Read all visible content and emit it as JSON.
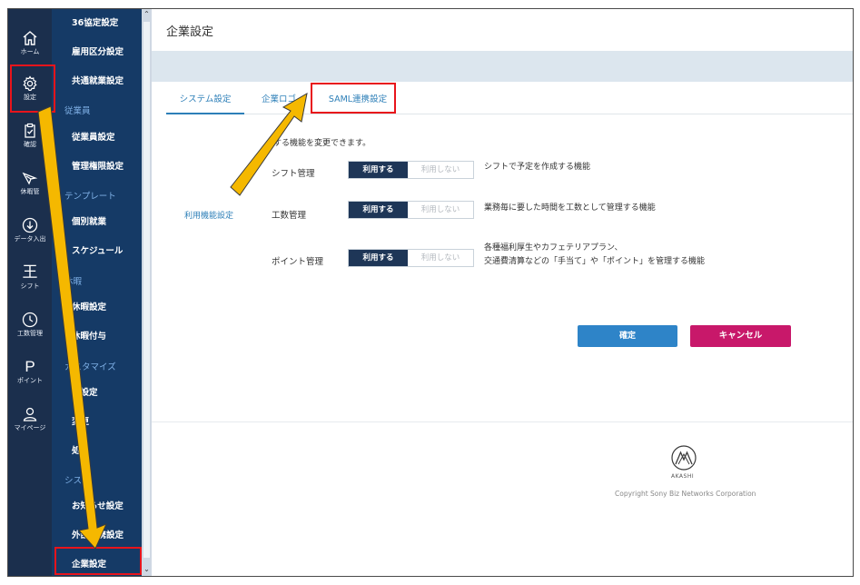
{
  "rail": {
    "items": [
      {
        "label": "ホーム",
        "icon": "home-icon"
      },
      {
        "label": "設定",
        "icon": "gear-icon"
      },
      {
        "label": "確認",
        "icon": "clipboard-icon"
      },
      {
        "label": "休暇管",
        "icon": "plane-icon"
      },
      {
        "label": "データ入出",
        "icon": "download-icon"
      },
      {
        "label": "シフト",
        "icon": "shift-icon",
        "glyph": "王"
      },
      {
        "label": "工数管理",
        "icon": "clock-icon"
      },
      {
        "label": "ポイント",
        "icon": "point-icon",
        "glyph": "P"
      },
      {
        "label": "マイページ",
        "icon": "user-icon"
      }
    ]
  },
  "submenu": {
    "items": [
      "36協定設定",
      "雇用区分設定",
      "共通就業設定",
      "従業員設定",
      "管理権限設定",
      "個別就業",
      "スケジュール",
      "休暇設定",
      "休暇付与",
      "目設定",
      "変更",
      "処理",
      "お知らせ設定",
      "外部連携設定",
      "企業設定"
    ],
    "sections": [
      "従業員",
      "テンプレート",
      "休暇",
      "カスタマイズ",
      "シス"
    ]
  },
  "main": {
    "title": "企業設定",
    "tabs": [
      "システム設定",
      "企業ロゴ",
      "SAML連携設定"
    ],
    "description": "する機能を変更できます。",
    "feature_label": "利用機能設定",
    "features": [
      {
        "name": "シフト管理",
        "on": "利用する",
        "off": "利用しない",
        "desc": [
          "シフトで予定を作成する機能"
        ]
      },
      {
        "name": "工数管理",
        "on": "利用する",
        "off": "利用しない",
        "desc": [
          "業務毎に要した時間を工数として管理する機能"
        ]
      },
      {
        "name": "ポイント管理",
        "on": "利用する",
        "off": "利用しない",
        "desc": [
          "各種福利厚生やカフェテリアプラン、",
          "交通費清算などの「手当て」や「ポイント」を管理する機能"
        ]
      }
    ],
    "confirm_label": "確定",
    "cancel_label": "キャンセル",
    "logo_text": "AKASHI",
    "copyright": "Copyright Sony Biz Networks Corporation"
  },
  "colors": {
    "rail_bg": "#1b2f4d",
    "submenu_bg": "#153a66",
    "accent": "#2d7fb8",
    "confirm": "#2e84c8",
    "cancel": "#c8186a",
    "annotation_red": "#e8141b",
    "annotation_arrow": "#f5b800"
  }
}
